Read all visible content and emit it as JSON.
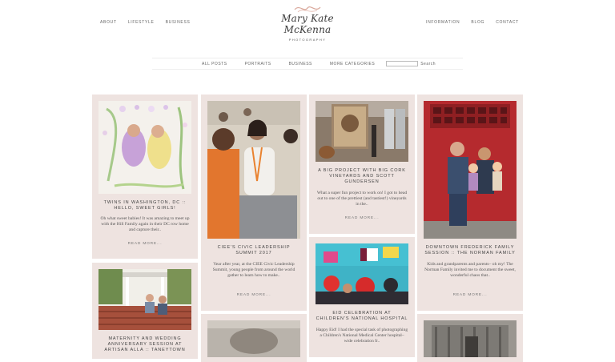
{
  "nav": {
    "about": "ABOUT",
    "lifestyle": "LIFESTYLE",
    "business": "BUSINESS",
    "information": "INFORMATION",
    "blog": "BLOG",
    "contact": "CONTACT"
  },
  "logo": {
    "name": "Mary Kate McKenna",
    "sub": "PHOTOGRAPHY"
  },
  "categories": {
    "all": "ALL POSTS",
    "portraits": "PORTRAITS",
    "business": "BUSINESS",
    "more": "MORE CATEGORIES",
    "search_button": "Search"
  },
  "posts": [
    {
      "title": "TWINS IN WASHINGTON, DC :: HELLO, SWEET GIRLS!",
      "excerpt": "Oh what sweet babies! It was amazing to meet up with the Hill Family again in their DC row home and capture their..",
      "read": "READ MORE..."
    },
    {
      "title": "CIEE'S CIVIC LEADERSHIP SUMMIT 2017",
      "excerpt": "Year after year, at the CIEE Civic Leadership Summit, young people from around the world gather to learn how to make..",
      "read": "READ MORE..."
    },
    {
      "title": "A BIG PROJECT WITH BIG CORK VINEYARDS AND SCOTT GUNDERSEN",
      "excerpt": "What a super fun project to work on! I got to head out to one of the prettiest (and tastiest!) vineyards in the..",
      "read": "READ MORE..."
    },
    {
      "title": "DOWNTOWN FREDERICK FAMILY SESSION :: THE NORMAN FAMILY",
      "excerpt": "Kids and grandparents and parents– oh my! The Norman Family invited me to document the sweet, wonderful chaos that..",
      "read": "READ MORE..."
    },
    {
      "title": "MATERNITY AND WEDDING ANNIVERSARY SESSION AT ARTISAN ALLA :: TANEYTOWN",
      "excerpt": "",
      "read": ""
    },
    {
      "title": "EID CELEBRATION AT CHILDREN'S NATIONAL HOSPITAL",
      "excerpt": "Happy Eid! I had the special task of photographing a Children's National Medical Center hospital–wide celebration fr..",
      "read": ""
    }
  ],
  "colors": {
    "card_bg": "#eee3e0",
    "page_bg": "#ffffff"
  }
}
